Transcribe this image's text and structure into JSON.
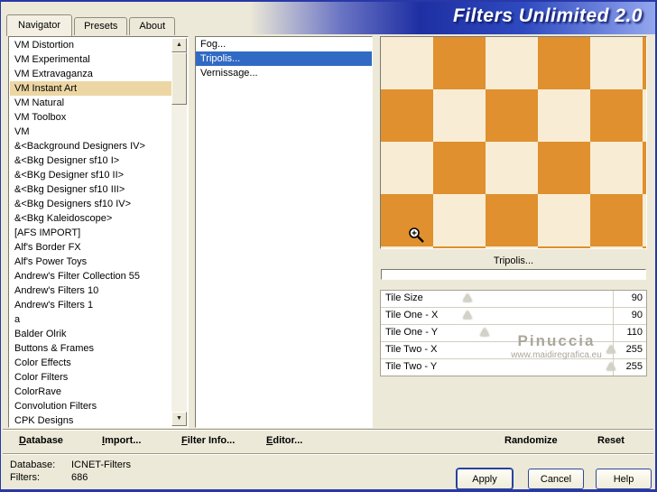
{
  "window": {
    "title": "Filters Unlimited 2.0"
  },
  "tabs": [
    {
      "label": "Navigator",
      "active": true
    },
    {
      "label": "Presets",
      "active": false
    },
    {
      "label": "About",
      "active": false
    }
  ],
  "icons": {
    "up_arrow": "▲",
    "down_arrow": "▼"
  },
  "categories": {
    "selected": "VM Instant Art",
    "items": [
      "VM Distortion",
      "VM Experimental",
      "VM Extravaganza",
      "VM Instant Art",
      "VM Natural",
      "VM Toolbox",
      "VM",
      "&<Background Designers IV>",
      "&<Bkg Designer sf10 I>",
      "&<BKg Designer sf10 II>",
      "&<Bkg Designer sf10 III>",
      "&<Bkg Designers sf10 IV>",
      "&<Bkg Kaleidoscope>",
      "[AFS IMPORT]",
      "Alf's Border FX",
      "Alf's Power Toys",
      "Andrew's Filter Collection 55",
      "Andrew's Filters 10",
      "Andrew's Filters 1",
      "a",
      "Balder Olrik",
      "Buttons & Frames",
      "Color Effects",
      "Color Filters",
      "ColorRave",
      "Convolution Filters",
      "CPK Designs"
    ]
  },
  "filters": {
    "selected": "Tripolis...",
    "items": [
      "Fog...",
      "Tripolis...",
      "Vernissage..."
    ]
  },
  "preview": {
    "filter_label": "Tripolis..."
  },
  "params": {
    "max": 255,
    "rows": [
      {
        "label": "Tile Size",
        "value": 90
      },
      {
        "label": "Tile One - X",
        "value": 90
      },
      {
        "label": "Tile One - Y",
        "value": 110
      },
      {
        "label": "Tile Two - X",
        "value": 255
      },
      {
        "label": "Tile Two - Y",
        "value": 255
      }
    ]
  },
  "toolbar": {
    "items": [
      {
        "label": "Database"
      },
      {
        "label": "Import..."
      },
      {
        "label": "Filter Info..."
      },
      {
        "label": "Editor..."
      },
      {
        "label": "Randomize"
      },
      {
        "label": "Reset"
      }
    ]
  },
  "status": {
    "database_label": "Database:",
    "database_value": "ICNET-Filters",
    "filters_label": "Filters:",
    "filters_value": "686"
  },
  "action_buttons": {
    "apply": "Apply",
    "cancel": "Cancel",
    "help": "Help"
  },
  "watermark": {
    "line1": "Pinuccia",
    "line2": "www.maidiregrafica.eu"
  },
  "colors": {
    "window_bg": "#ece9d8",
    "selection_blue": "#316ac5",
    "category_highlight": "#ecd7a4",
    "pattern_orange": "#e0902e",
    "pattern_cream": "#f9ecd4",
    "edge_navy": "#2838a8"
  }
}
